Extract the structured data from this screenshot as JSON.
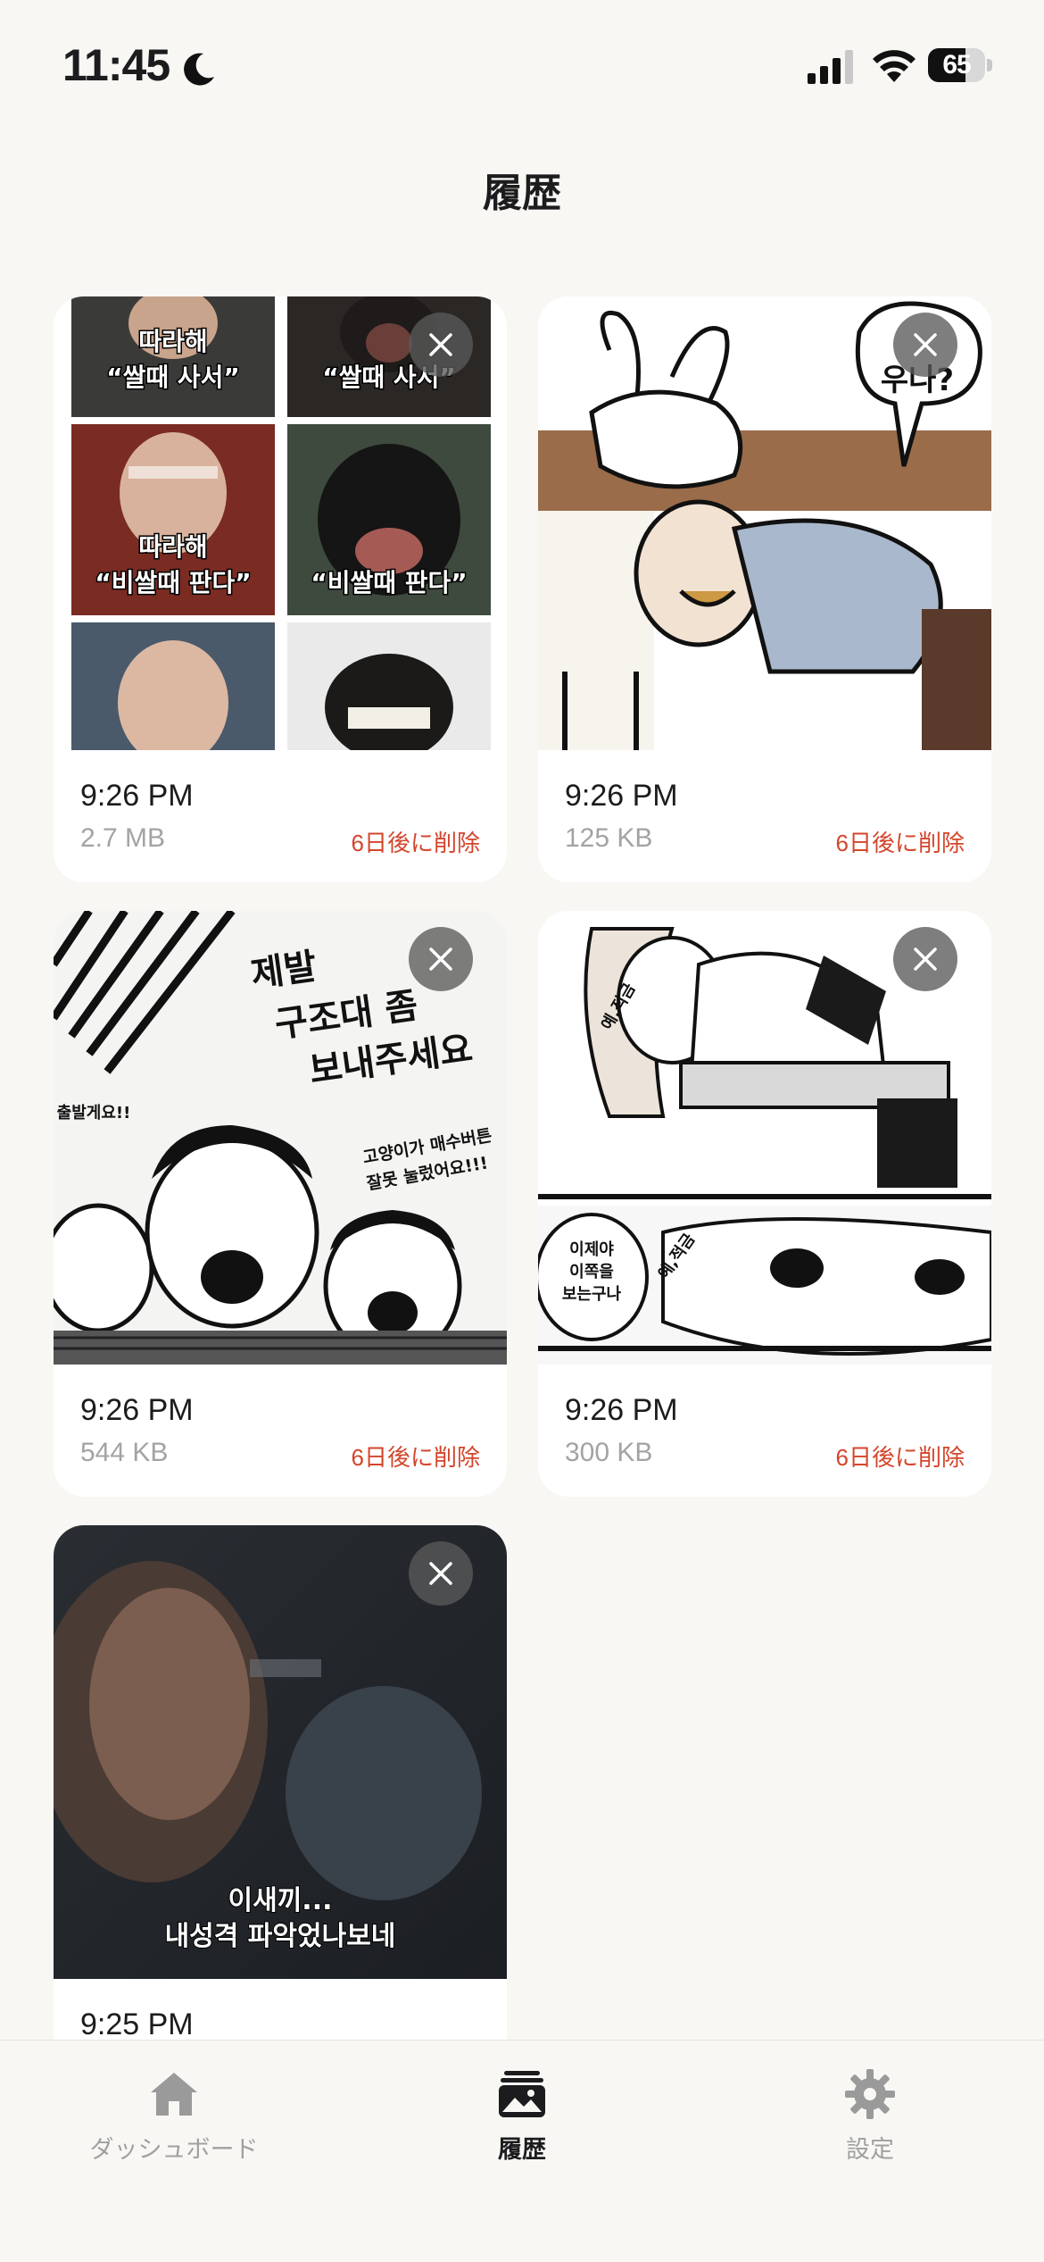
{
  "status_bar": {
    "time": "11:45",
    "battery": "65"
  },
  "header": {
    "title": "履歴"
  },
  "history": [
    {
      "time": "9:26 PM",
      "size": "2.7 MB",
      "expire": "6日後に削除",
      "caption": [
        "따라해",
        "“쌀때 사서”",
        "“쌀때 사서”",
        "따라해",
        "“비쌀때 판다”",
        "“비쌀때 판다”"
      ]
    },
    {
      "time": "9:26 PM",
      "size": "125 KB",
      "expire": "6日後に削除",
      "caption": [
        "우나?"
      ]
    },
    {
      "time": "9:26 PM",
      "size": "544 KB",
      "expire": "6日後に削除",
      "caption": [
        "제발",
        "구조대 좀",
        "보내주세요",
        "출발게요!!",
        "고양이가 매수버튼",
        "잘못 눌렀어요!!!"
      ]
    },
    {
      "time": "9:26 PM",
      "size": "300 KB",
      "expire": "6日後に削除",
      "caption": [
        "예,적금",
        "이제야",
        "이쪽을",
        "보는구나",
        "예,적금"
      ]
    },
    {
      "time": "9:25 PM",
      "size": "",
      "expire": "",
      "caption": [
        "이새끼...",
        "내성격 파악었나보네"
      ]
    }
  ],
  "tabs": [
    {
      "label": "ダッシュボード",
      "icon": "home-icon",
      "active": false
    },
    {
      "label": "履歴",
      "icon": "gallery-icon",
      "active": true
    },
    {
      "label": "設定",
      "icon": "gear-icon",
      "active": false
    }
  ],
  "colors": {
    "background": "#f8f7f4",
    "expire_text": "#d3462c",
    "muted": "#a3a3a3"
  }
}
